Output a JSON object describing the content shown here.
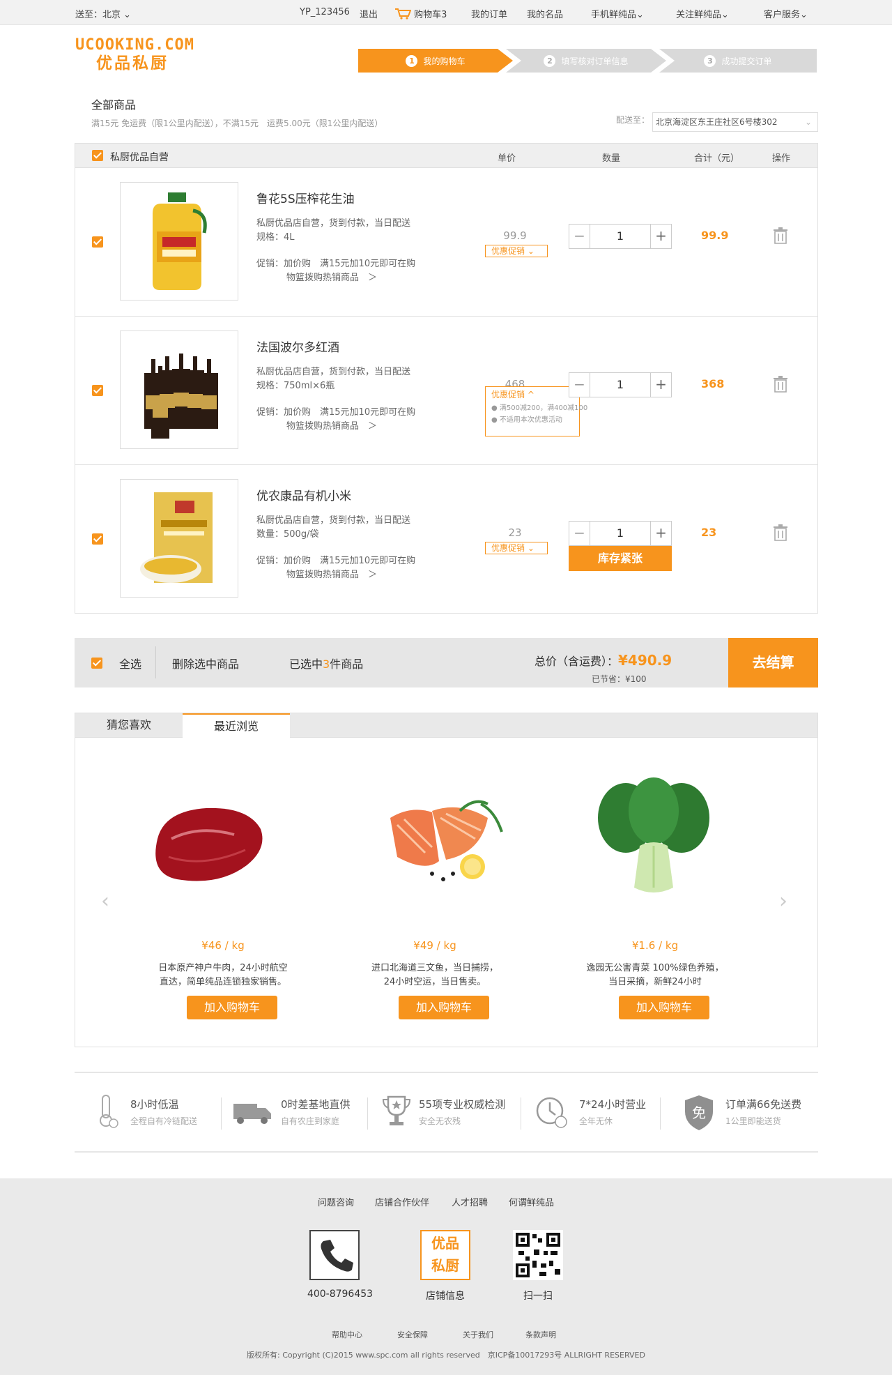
{
  "topbar": {
    "location": "送至：北京",
    "username": "YP_123456",
    "logout": "退出",
    "cart_label": "购物车",
    "cart_count": "3",
    "my_orders": "我的订单",
    "my_favorites": "我的名品",
    "mobile": "手机鲜纯品",
    "follow": "关注鲜纯品",
    "service": "客户服务"
  },
  "logo": {
    "en": "UCOOKING.COM",
    "cn": "优品私厨"
  },
  "steps": [
    {
      "num": "1",
      "label": "我的购物车"
    },
    {
      "num": "2",
      "label": "填写核对订单信息"
    },
    {
      "num": "3",
      "label": "成功提交订单"
    }
  ],
  "cart_info": {
    "all_goods": "全部商品",
    "ship_note": "满15元 免运费（限1公里内配送），不满15元　运费5.00元（限1公里内配送）",
    "deliver_label": "配送至：",
    "address": "北京海淀区东王庄社区6号楼302"
  },
  "cart_header": {
    "store": "私厨优品自营",
    "unit_price": "单价",
    "quantity": "数量",
    "subtotal": "合计（元）",
    "action": "操作"
  },
  "items": [
    {
      "name": "鲁花5S压榨花生油",
      "line1": "私厨优品店自营，货到付款，当日配送",
      "line2": "规格：4L",
      "promo1": "促销：加价购　满15元加10元即可在购",
      "promo2": "物篮拨购热销商品　＞",
      "unit_price": "99.9",
      "promo_tag": "优惠促销 ⌄",
      "qty": "1",
      "subtotal": "99.9"
    },
    {
      "name": "法国波尔多红酒",
      "line1": "私厨优品店自营，货到付款，当日配送",
      "line2": "规格：750ml×6瓶",
      "promo1": "促销：加价购　满15元加10元即可在购",
      "promo2": "物篮拨购热销商品　＞",
      "unit_price": "468",
      "promo_tag": "优惠促销 ^",
      "promo_opt1": "满500减200，满400减100",
      "promo_opt2": "不适用本次优惠活动",
      "qty": "1",
      "subtotal": "368"
    },
    {
      "name": "优农康品有机小米",
      "line1": "私厨优品店自营，货到付款，当日配送",
      "line2": "数量：500g/袋",
      "promo1": "促销：加价购　满15元加10元即可在购",
      "promo2": "物篮拨购热销商品　＞",
      "unit_price": "23",
      "promo_tag": "优惠促销 ⌄",
      "qty": "1",
      "stock": "库存紧张",
      "subtotal": "23"
    }
  ],
  "summary": {
    "select_all": "全选",
    "delete_selected": "删除选中商品",
    "selected_pre": "已选中",
    "selected_count": "3",
    "selected_post": "件商品",
    "total_label": "总价（含运费）：",
    "total": "¥490.9",
    "saved": "已节省：¥100",
    "checkout": "去结算"
  },
  "recommend": {
    "tabs": [
      "猜您喜欢",
      "最近浏览"
    ],
    "products": [
      {
        "price": "¥46 / kg",
        "desc1": "日本原产神户牛肉，24小时航空",
        "desc2": "直达，简单纯品连锁独家销售。",
        "btn": "加入购物车"
      },
      {
        "price": "¥49 / kg",
        "desc1": "进口北海道三文鱼，当日捕捞，",
        "desc2": "24小时空运，当日售卖。",
        "btn": "加入购物车"
      },
      {
        "price": "¥1.6 / kg",
        "desc1": "逸园无公害青菜 100%绿色养殖，",
        "desc2": "当日采摘，新鲜24小时",
        "btn": "加入购物车"
      }
    ]
  },
  "features": [
    {
      "title": "8小时低温",
      "sub": "全程自有冷链配送"
    },
    {
      "title": "0时差基地直供",
      "sub": "自有农庄到家庭"
    },
    {
      "title": "55项专业权威检测",
      "sub": "安全无农残"
    },
    {
      "title": "7*24小时营业",
      "sub": "全年无休"
    },
    {
      "title": "订单满66免送费",
      "sub": "1公里即能送货"
    }
  ],
  "footer": {
    "links": [
      "问题咨询",
      "店铺合作伙伴",
      "人才招聘",
      "何谓鲜纯品"
    ],
    "phone": "400-8796453",
    "store_info": "店铺信息",
    "scan": "扫一扫",
    "logo_top": "优品",
    "logo_bottom": "私厨",
    "small_links": [
      "帮助中心",
      "安全保障",
      "关于我们",
      "条款声明"
    ],
    "copyright": "版权所有: Copyright (C)2015 www.spc.com all rights reserved　京ICP备10017293号 ALLRIGHT RESERVED"
  },
  "colors": {
    "accent": "#f7941d",
    "bar_bg": "#e6e6e6"
  }
}
